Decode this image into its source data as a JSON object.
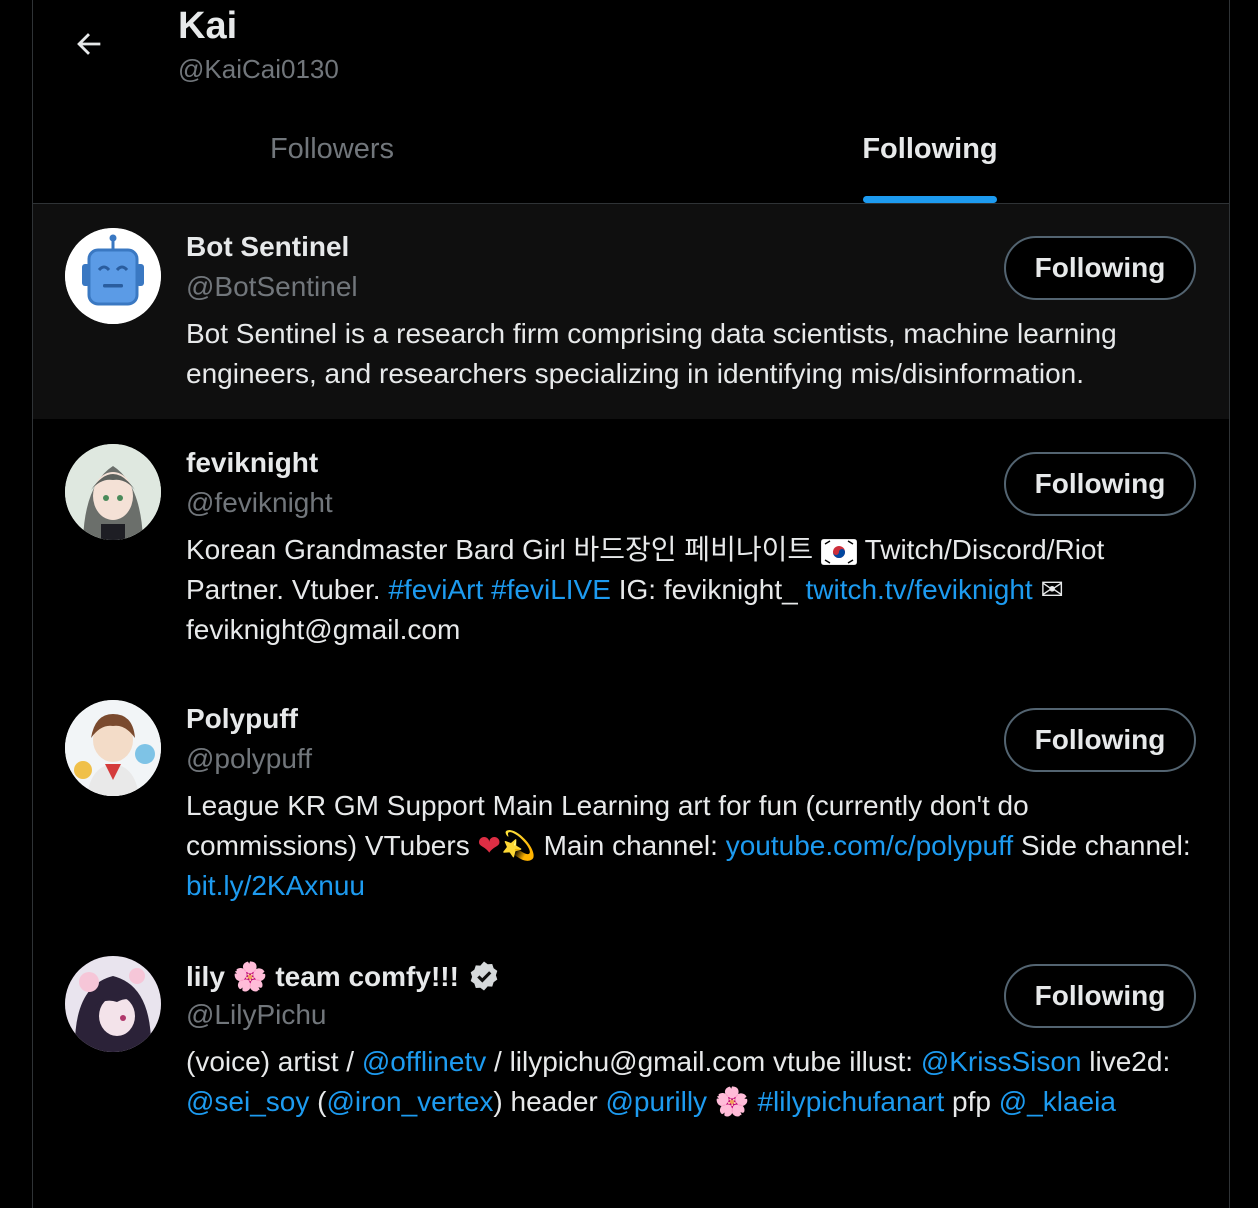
{
  "header": {
    "title": "Kai",
    "handle": "@KaiCai0130"
  },
  "tabs": [
    {
      "label": "Followers"
    },
    {
      "label": "Following"
    }
  ],
  "users": [
    {
      "name": "Bot Sentinel",
      "handle": "@BotSentinel",
      "button": "Following",
      "bio": [
        {
          "t": "Bot Sentinel is a research firm comprising data scientists, machine learning engineers, and researchers specializing in identifying mis/disinformation."
        }
      ]
    },
    {
      "name": "feviknight",
      "handle": "@feviknight",
      "button": "Following",
      "bio": [
        {
          "t": "Korean Grandmaster Bard Girl 바드장인 페비나이트 "
        },
        {
          "t": " Twitch/Discord/Riot Partner. Vtuber. "
        },
        {
          "t": "#feviArt",
          "link": true
        },
        {
          "t": " "
        },
        {
          "t": "#feviLIVE",
          "link": true
        },
        {
          "t": " IG: feviknight_ "
        },
        {
          "t": "twitch.tv/feviknight",
          "link": true
        },
        {
          "t": " ✉ feviknight@gmail.com"
        }
      ]
    },
    {
      "name": "Polypuff",
      "handle": "@polypuff",
      "button": "Following",
      "bio": [
        {
          "t": "League KR GM Support Main Learning art for fun (currently don't do commissions) VTubers "
        },
        {
          "t": "❤",
          "heart": true
        },
        {
          "t": "💫 Main channel: "
        },
        {
          "t": "youtube.com/c/polypuff",
          "link": true
        },
        {
          "t": " Side channel: "
        },
        {
          "t": "bit.ly/2KAxnuu",
          "link": true
        }
      ]
    },
    {
      "name": "lily 🌸 team comfy!!!",
      "handle": "@LilyPichu",
      "button": "Following",
      "bio": [
        {
          "t": "(voice) artist / "
        },
        {
          "t": "@offlinetv",
          "link": true
        },
        {
          "t": " / lilypichu@gmail.com vtube illust: "
        },
        {
          "t": "@KrissSison",
          "link": true
        },
        {
          "t": " live2d: "
        },
        {
          "t": "@sei_soy",
          "link": true
        },
        {
          "t": " ("
        },
        {
          "t": "@iron_vertex",
          "link": true
        },
        {
          "t": ") header "
        },
        {
          "t": "@purilly",
          "link": true
        },
        {
          "t": " 🌸 "
        },
        {
          "t": "#lilypichufanart",
          "link": true
        },
        {
          "t": " pfp "
        },
        {
          "t": "@_klaeia",
          "link": true
        }
      ]
    }
  ],
  "colors": {
    "accent": "#1d9bf0",
    "text": "#e7e9ea",
    "muted": "#71767b",
    "border": "#2f3336"
  },
  "icons": {
    "back": "arrow-left-icon",
    "verified": "verified-badge-icon",
    "flag": "korea-flag-icon"
  }
}
